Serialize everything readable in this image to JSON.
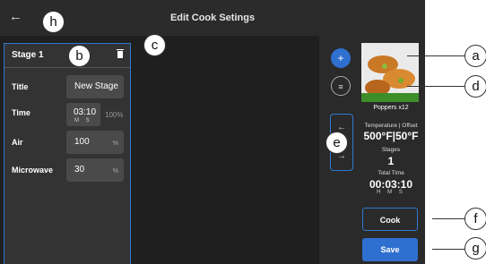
{
  "header": {
    "title": "Edit Cook Setings",
    "back_icon": "←"
  },
  "stage": {
    "title": "Stage 1",
    "fields": [
      {
        "label": "Title",
        "value": "New Stage",
        "unit": ""
      },
      {
        "label": "Time",
        "value": "03:10",
        "unit": ""
      },
      {
        "label": "Air",
        "value": "100",
        "unit": "%"
      },
      {
        "label": "Microwave",
        "value": "30",
        "unit": "%"
      }
    ],
    "time_units": "M S",
    "time_percent": "100%"
  },
  "tools": {
    "add_icon": "+",
    "memo_icon": "≡",
    "up_icon": "←",
    "down_icon": "→"
  },
  "summary": {
    "food_name": "Poppers x12",
    "temperature_label": "Temperature | Offset",
    "temperature_value": "500°F|50°F",
    "stages_label": "Stages",
    "stages_value": "1",
    "total_time_label": "Total Time",
    "total_time_value": "00:03:10",
    "total_time_units": "H M S"
  },
  "actions": {
    "cook_label": "Cook",
    "save_label": "Save"
  },
  "callouts": {
    "h": "h",
    "b": "b",
    "c": "c",
    "e": "e",
    "a": "a",
    "d": "d",
    "f": "f",
    "g": "g"
  }
}
